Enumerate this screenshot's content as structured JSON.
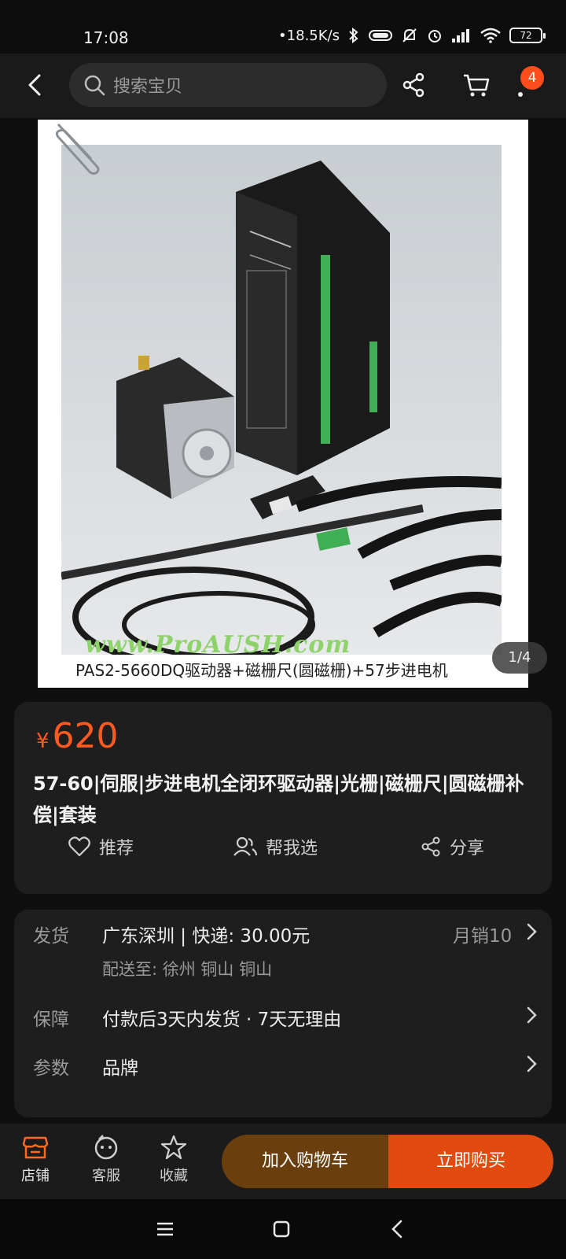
{
  "status_bar": {
    "time": "17:08",
    "net_speed": "•18.5K/s",
    "battery": "72"
  },
  "header": {
    "search_placeholder": "搜索宝贝",
    "cart_badge": "4"
  },
  "gallery": {
    "watermark": "www.ProAUSH.com",
    "caption": "PAS2-5660DQ驱动器+磁栅尺(圆磁栅)+57步进电机",
    "counter": "1/4"
  },
  "product": {
    "currency": "¥",
    "price": "620",
    "title": "57-60|伺服|步进电机全闭环驱动器|光栅|磁栅尺|圆磁栅补偿|套装",
    "actions": {
      "recommend": "推荐",
      "help_choose": "帮我选",
      "share": "分享"
    }
  },
  "info": {
    "shipping_label": "发货",
    "shipping_value": "广东深圳  |  快递: 30.00元",
    "monthly_sales": "月销10",
    "deliver_to": "配送至: 徐州 铜山 铜山",
    "guarantee_label": "保障",
    "guarantee_value": "付款后3天内发货  ·  7天无理由",
    "params_label": "参数",
    "params_value": "品牌"
  },
  "bottom_bar": {
    "store": "店铺",
    "service": "客服",
    "favorite": "收藏",
    "add_to_cart": "加入购物车",
    "buy_now": "立即购买"
  },
  "colors": {
    "accent": "#ff5a1f",
    "buy": "#e14b10",
    "cart": "#6b3f0d",
    "card": "#1e1e1e"
  }
}
